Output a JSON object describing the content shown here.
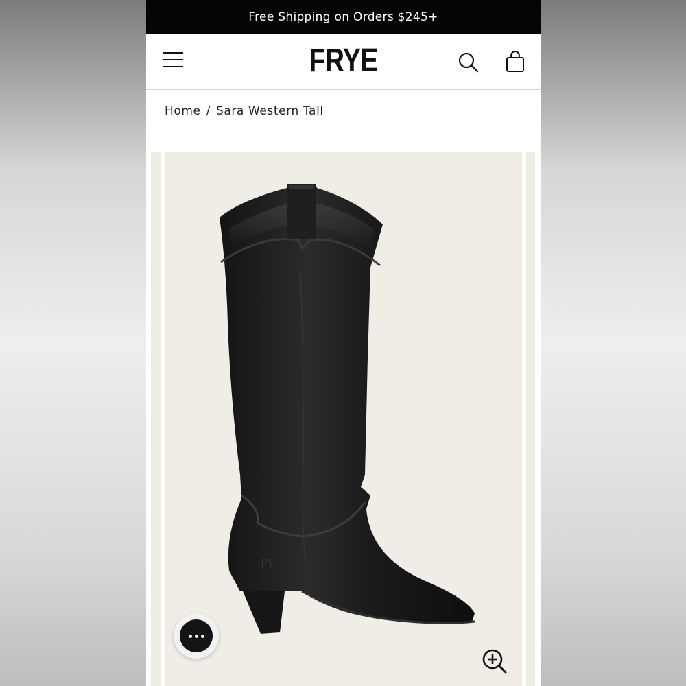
{
  "promo": {
    "text": "Free Shipping on Orders $245+"
  },
  "header": {
    "logo": "FRYE",
    "menu_icon": "hamburger-icon",
    "search_icon": "search-icon",
    "bag_icon": "shopping-bag-icon"
  },
  "breadcrumb": {
    "home": "Home",
    "separator": "/",
    "current": "Sara Western Tall"
  },
  "gallery": {
    "image": "black-western-tall-boot",
    "zoom_icon": "zoom-in-icon"
  },
  "chat": {
    "icon": "chat-icon"
  },
  "colors": {
    "promo_bg": "#050505",
    "image_bg": "#efede6",
    "text": "#222222"
  }
}
